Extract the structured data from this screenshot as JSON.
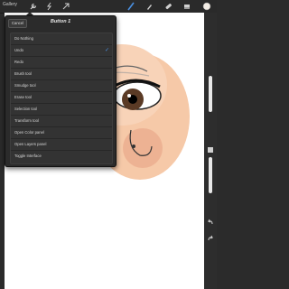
{
  "toolbar": {
    "gallery_label": "Gallery",
    "accent_color": "#4a90e2"
  },
  "popover": {
    "title": "Button 1",
    "cancel_label": "Cancel",
    "selected_index": 1,
    "items": [
      "Do Nothing",
      "Undo",
      "Redo",
      "Brush tool",
      "Smudge tool",
      "Erase tool",
      "Selection tool",
      "Transform tool",
      "Open Color panel",
      "Open Layers panel",
      "Toggle Interface"
    ]
  },
  "colors": {
    "skin": "#f6c9a8",
    "iris": "#5a3a25",
    "toolbar": "#2a2a2a"
  }
}
